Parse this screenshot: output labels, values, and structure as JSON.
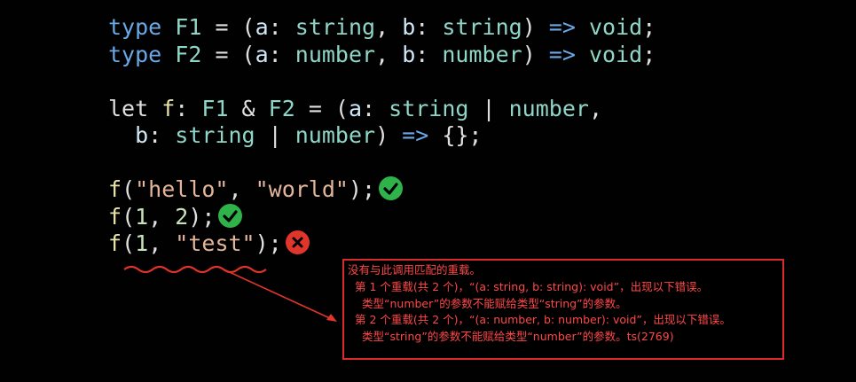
{
  "code": {
    "lines": [
      [
        {
          "t": "type",
          "c": "kw"
        },
        {
          "t": " ",
          "c": "id"
        },
        {
          "t": "F1",
          "c": "ty"
        },
        {
          "t": " = (",
          "c": "id"
        },
        {
          "t": "a",
          "c": "param"
        },
        {
          "t": ": ",
          "c": "id"
        },
        {
          "t": "string",
          "c": "ty"
        },
        {
          "t": ", ",
          "c": "id"
        },
        {
          "t": "b",
          "c": "param"
        },
        {
          "t": ": ",
          "c": "id"
        },
        {
          "t": "string",
          "c": "ty"
        },
        {
          "t": ") ",
          "c": "id"
        },
        {
          "t": "=>",
          "c": "arrow"
        },
        {
          "t": " ",
          "c": "id"
        },
        {
          "t": "void",
          "c": "ty"
        },
        {
          "t": ";",
          "c": "id"
        }
      ],
      [
        {
          "t": "type",
          "c": "kw"
        },
        {
          "t": " ",
          "c": "id"
        },
        {
          "t": "F2",
          "c": "ty"
        },
        {
          "t": " = (",
          "c": "id"
        },
        {
          "t": "a",
          "c": "param"
        },
        {
          "t": ": ",
          "c": "id"
        },
        {
          "t": "number",
          "c": "ty"
        },
        {
          "t": ", ",
          "c": "id"
        },
        {
          "t": "b",
          "c": "param"
        },
        {
          "t": ": ",
          "c": "id"
        },
        {
          "t": "number",
          "c": "ty"
        },
        {
          "t": ") ",
          "c": "id"
        },
        {
          "t": "=>",
          "c": "arrow"
        },
        {
          "t": " ",
          "c": "id"
        },
        {
          "t": "void",
          "c": "ty"
        },
        {
          "t": ";",
          "c": "id"
        }
      ],
      [],
      [
        {
          "t": "let",
          "c": "id"
        },
        {
          "t": " ",
          "c": "id"
        },
        {
          "t": "f",
          "c": "fn"
        },
        {
          "t": ": ",
          "c": "id"
        },
        {
          "t": "F1",
          "c": "ty"
        },
        {
          "t": " & ",
          "c": "id"
        },
        {
          "t": "F2",
          "c": "ty"
        },
        {
          "t": " = (",
          "c": "id"
        },
        {
          "t": "a",
          "c": "param"
        },
        {
          "t": ": ",
          "c": "id"
        },
        {
          "t": "string",
          "c": "ty"
        },
        {
          "t": " | ",
          "c": "id"
        },
        {
          "t": "number",
          "c": "ty"
        },
        {
          "t": ",",
          "c": "id"
        }
      ],
      [
        {
          "t": "  ",
          "c": "id"
        },
        {
          "t": "b",
          "c": "param"
        },
        {
          "t": ": ",
          "c": "id"
        },
        {
          "t": "string",
          "c": "ty"
        },
        {
          "t": " | ",
          "c": "id"
        },
        {
          "t": "number",
          "c": "ty"
        },
        {
          "t": ") ",
          "c": "id"
        },
        {
          "t": "=>",
          "c": "arrow"
        },
        {
          "t": " {};",
          "c": "id"
        }
      ],
      [],
      [
        {
          "t": "f",
          "c": "fn"
        },
        {
          "t": "(",
          "c": "id"
        },
        {
          "t": "\"hello\"",
          "c": "str"
        },
        {
          "t": ", ",
          "c": "id"
        },
        {
          "t": "\"world\"",
          "c": "str"
        },
        {
          "t": ");",
          "c": "id"
        }
      ],
      [
        {
          "t": "f",
          "c": "fn"
        },
        {
          "t": "(",
          "c": "id"
        },
        {
          "t": "1",
          "c": "num"
        },
        {
          "t": ", ",
          "c": "id"
        },
        {
          "t": "2",
          "c": "num"
        },
        {
          "t": ");",
          "c": "id"
        }
      ],
      [
        {
          "t": "f",
          "c": "fn"
        },
        {
          "t": "(",
          "c": "id"
        },
        {
          "t": "1",
          "c": "num"
        },
        {
          "t": ", ",
          "c": "id"
        },
        {
          "t": "\"test\"",
          "c": "str"
        },
        {
          "t": ");",
          "c": "id"
        }
      ]
    ],
    "status_icons": {
      "6": "check-circle-icon",
      "7": "check-circle-icon",
      "8": "x-circle-icon"
    }
  },
  "tooltip": {
    "lines": [
      "没有与此调用匹配的重载。",
      "第 1 个重载(共 2 个)，“(a: string, b: string): void”，出现以下错误。",
      "类型“number”的参数不能赋给类型“string”的参数。",
      "第 2 个重载(共 2 个)，“(a: number, b: number): void”，出现以下错误。",
      "类型“string”的参数不能赋给类型“number”的参数。ts(2769)"
    ]
  },
  "colors": {
    "background": "#010101",
    "keyword": "#6aa9e8",
    "type": "#8fd6c8",
    "string": "#e3b59a",
    "ok": "#2fb24a",
    "error": "#e0352b",
    "tooltip_text": "#ff4747",
    "tooltip_border": "#d8292b"
  }
}
